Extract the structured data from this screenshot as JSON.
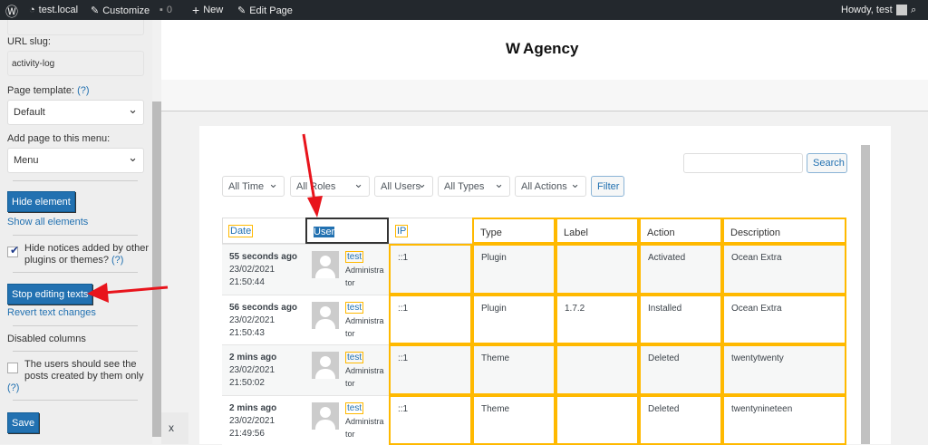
{
  "adminbar": {
    "site": "test.local",
    "customize": "Customize",
    "comments": "0",
    "new": "New",
    "edit": "Edit Page",
    "howdy": "Howdy, test"
  },
  "sidebar": {
    "url_slug_label": "URL slug:",
    "url_slug_value": "activity-log",
    "page_template_label": "Page template:",
    "help": "(?)",
    "page_template_value": "Default",
    "menu_label": "Add page to this menu:",
    "menu_value": "Menu",
    "hide_element": "Hide element",
    "show_all": "Show all elements",
    "hide_notices_line1": "Hide notices added by other",
    "hide_notices_line2": "plugins or themes?",
    "hide_notices_checked": true,
    "stop_editing": "Stop editing texts",
    "revert": "Revert text changes",
    "disabled_columns": "Disabled columns",
    "own_posts_line1": "The users should see the",
    "own_posts_line2": "posts created by them only",
    "own_posts_checked": false,
    "save": "Save",
    "close": "x"
  },
  "logo": {
    "text": "Agency",
    "mark": "W",
    "accent": "#f5a623"
  },
  "filters": {
    "time": "All Time",
    "roles": "All Roles",
    "users": "All Users",
    "types": "All Types",
    "actions": "All Actions",
    "filter": "Filter",
    "search": "Search",
    "search_value": ""
  },
  "table": {
    "headers": [
      "Date",
      "User",
      "IP",
      "Type",
      "Label",
      "Action",
      "Description"
    ],
    "rows": [
      {
        "ago": "55 seconds ago",
        "date": "23/02/2021",
        "time": "21:50:44",
        "user": "test",
        "role1": "Administra",
        "role2": "tor",
        "ip": "::1",
        "type": "Plugin",
        "label": "",
        "action": "Activated",
        "desc": "Ocean Extra"
      },
      {
        "ago": "56 seconds ago",
        "date": "23/02/2021",
        "time": "21:50:43",
        "user": "test",
        "role1": "Administra",
        "role2": "tor",
        "ip": "::1",
        "type": "Plugin",
        "label": "1.7.2",
        "action": "Installed",
        "desc": "Ocean Extra"
      },
      {
        "ago": "2 mins ago",
        "date": "23/02/2021",
        "time": "21:50:02",
        "user": "test",
        "role1": "Administra",
        "role2": "tor",
        "ip": "::1",
        "type": "Theme",
        "label": "",
        "action": "Deleted",
        "desc": "twentytwenty"
      },
      {
        "ago": "2 mins ago",
        "date": "23/02/2021",
        "time": "21:49:56",
        "user": "test",
        "role1": "Administra",
        "role2": "tor",
        "ip": "::1",
        "type": "Theme",
        "label": "",
        "action": "Deleted",
        "desc": "twentynineteen"
      }
    ]
  },
  "colors": {
    "highlight": "#ffb900",
    "arrow": "#e8141c",
    "primary": "#2271b1"
  }
}
